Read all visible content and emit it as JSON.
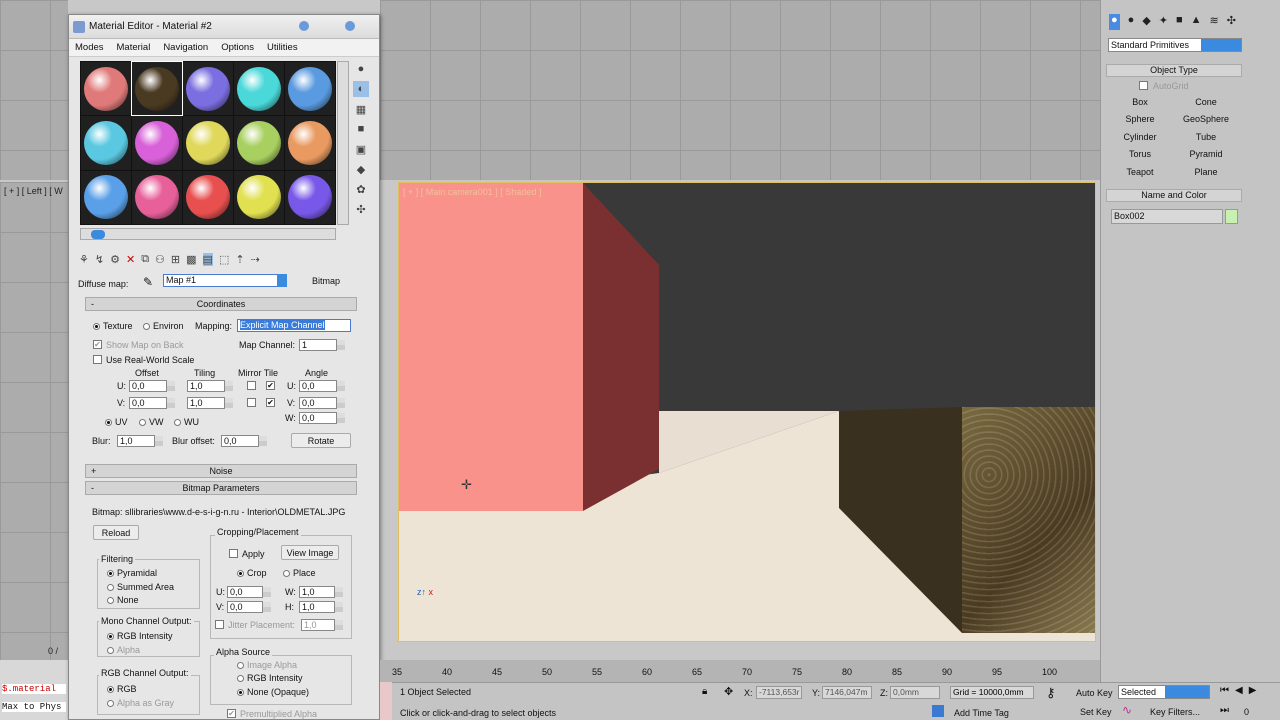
{
  "viewports": {
    "left_label": "[ + ] [ Left ] [ W",
    "camera_label": "[ + ] [ Main camera001 ] [ Shaded ]",
    "bottom_left_text1": "$.material",
    "bottom_left_text2": "Max to Phys",
    "ortho_counter": "0 /"
  },
  "material_editor": {
    "title": "Material Editor - Material #2",
    "menu": [
      "Modes",
      "Material",
      "Navigation",
      "Options",
      "Utilities"
    ],
    "diffuse_label": "Diffuse map:",
    "map_name": "Map #1",
    "map_type": "Bitmap",
    "coordinates": {
      "header": "Coordinates",
      "texture": "Texture",
      "environ": "Environ",
      "mapping_label": "Mapping:",
      "mapping_value": "Explicit Map Channel",
      "show_map_on_back": "Show Map on Back",
      "map_channel_label": "Map Channel:",
      "map_channel_value": "1",
      "use_real_world": "Use Real-World Scale",
      "offset": "Offset",
      "tiling": "Tiling",
      "mirror_tile": "Mirror Tile",
      "angle": "Angle",
      "u_label": "U:",
      "v_label": "V:",
      "w_label": "W:",
      "u_offset": "0,0",
      "v_offset": "0,0",
      "u_tiling": "1,0",
      "v_tiling": "1,0",
      "u_angle": "0,0",
      "v_angle": "0,0",
      "w_angle": "0,0",
      "uv": "UV",
      "vw": "VW",
      "wu": "WU",
      "blur_label": "Blur:",
      "blur_value": "1,0",
      "blur_offset_label": "Blur offset:",
      "blur_offset_value": "0,0",
      "rotate": "Rotate"
    },
    "noise_header": "Noise",
    "bitmap_params": {
      "header": "Bitmap Parameters",
      "bitmap_path": "Bitmap: sllibraries\\www.d-e-s-i-g-n.ru - Interior\\OLDMETAL.JPG",
      "reload": "Reload",
      "cropping": "Cropping/Placement",
      "apply": "Apply",
      "view_image": "View Image",
      "crop": "Crop",
      "place": "Place",
      "u_label": "U:",
      "v_label": "V:",
      "w_label": "W:",
      "h_label": "H:",
      "u_value": "0,0",
      "v_value": "0,0",
      "w_value": "1,0",
      "h_value": "1,0",
      "jitter": "Jitter Placement:",
      "jitter_value": "1,0",
      "filtering": "Filtering",
      "pyramidal": "Pyramidal",
      "summed_area": "Summed Area",
      "none": "None",
      "mono_output": "Mono Channel Output:",
      "rgb_intensity": "RGB Intensity",
      "alpha": "Alpha",
      "rgb_output": "RGB Channel Output:",
      "rgb": "RGB",
      "alpha_as_gray": "Alpha as Gray",
      "alpha_source": "Alpha Source",
      "image_alpha": "Image Alpha",
      "rgb_intensity2": "RGB Intensity",
      "none_opaque": "None (Opaque)",
      "premultiplied": "Premultiplied Alpha"
    },
    "sphere_colors": [
      "#e07a7a",
      "#4a3a22",
      "#7a6ee0",
      "#4ad8d8",
      "#5a9ae0",
      "#5ac8e0",
      "#d860d8",
      "#e0d85a",
      "#a8d060",
      "#e89a60",
      "#5aa0e8",
      "#e8609a",
      "#e85050",
      "#e0e050",
      "#7858e8"
    ]
  },
  "command_panel": {
    "dropdown": "Standard Primitives",
    "object_type": "Object Type",
    "autogrid": "AutoGrid",
    "buttons": [
      "Box",
      "Cone",
      "Sphere",
      "GeoSphere",
      "Cylinder",
      "Tube",
      "Torus",
      "Pyramid",
      "Teapot",
      "Plane"
    ],
    "name_and_color": "Name and Color",
    "object_name": "Box002",
    "object_color": "#c8f0b0"
  },
  "timeline": {
    "ticks": [
      "35",
      "40",
      "45",
      "50",
      "55",
      "60",
      "65",
      "70",
      "75",
      "80",
      "85",
      "90",
      "95",
      "100"
    ]
  },
  "status": {
    "selected": "1 Object Selected",
    "prompt": "Click or click-and-drag to select objects",
    "x_label": "X:",
    "x_value": "-7113,653r",
    "y_label": "Y:",
    "y_value": "7146,047m",
    "z_label": "Z:",
    "z_value": "0,0mm",
    "grid": "Grid = 10000,0mm",
    "auto_key": "Auto Key",
    "selected_mode": "Selected",
    "set_key": "Set Key",
    "key_filters": "Key Filters...",
    "add_time_tag": "Add Time Tag",
    "frame": "0"
  }
}
